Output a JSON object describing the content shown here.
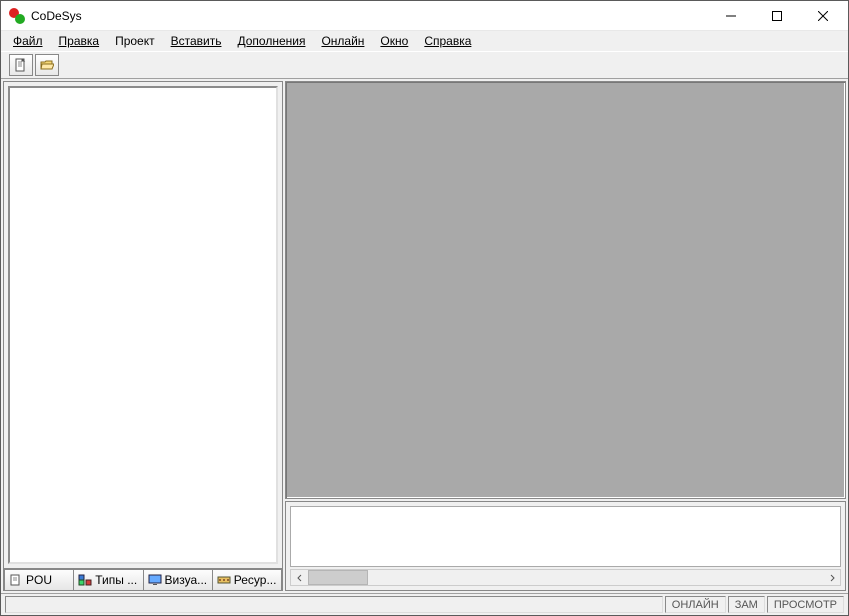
{
  "title": "CoDeSys",
  "menu": {
    "file": "Файл",
    "edit": "Правка",
    "project": "Проект",
    "insert": "Вставить",
    "extras": "Дополнения",
    "online": "Онлайн",
    "window": "Окно",
    "help": "Справка"
  },
  "left_tabs": {
    "pou": "POU",
    "datatypes": "Типы ...",
    "visualizations": "Визуа...",
    "resources": "Ресур..."
  },
  "status": {
    "online": "ОНЛАЙН",
    "overwrite": "ЗАМ",
    "monitor": "ПРОСМОТР"
  }
}
